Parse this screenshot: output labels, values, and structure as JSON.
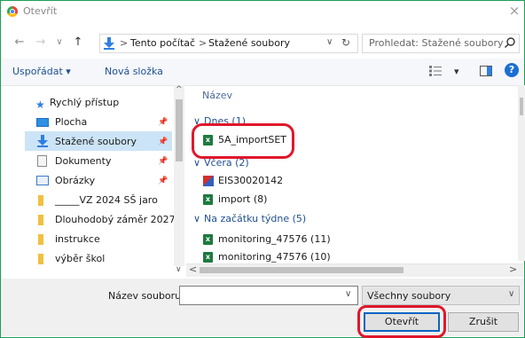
{
  "window": {
    "title": "Otevřít",
    "close": "×"
  },
  "nav": {
    "back": "←",
    "forward": "→",
    "dropdown": "∨",
    "up": "↑",
    "crumbs": [
      "Tento počítač",
      "Stažené soubory"
    ],
    "crumb_sep": ">",
    "addr_dropdown": "∨",
    "refresh": "↻",
    "search_placeholder": "Prohledat: Stažené soubory"
  },
  "toolbar": {
    "organize": "Uspořádat ▾",
    "new_folder": "Nová složka",
    "view_menu": "▾",
    "help": "?"
  },
  "sidebar": {
    "items": [
      {
        "label": "Rychlý přístup",
        "icon": "star-icon"
      },
      {
        "label": "Plocha",
        "icon": "desktop-icon"
      },
      {
        "label": "Stažené soubory",
        "icon": "downloads-icon"
      },
      {
        "label": "Dokumenty",
        "icon": "documents-icon"
      },
      {
        "label": "Obrázky",
        "icon": "pictures-icon"
      },
      {
        "label": "_____VZ 2024 SŠ jaro",
        "icon": "folder-icon"
      },
      {
        "label": "Dlouhodobý záměr 2027",
        "icon": "folder-icon"
      },
      {
        "label": "instrukce",
        "icon": "folder-icon"
      },
      {
        "label": "výběr škol",
        "icon": "folder-icon"
      }
    ]
  },
  "files": {
    "column_header": "Název",
    "groups": [
      {
        "label": "Dnes (1)",
        "items": [
          "5A_importSET"
        ]
      },
      {
        "label": "Včera (2)",
        "items": [
          "EIS30020142",
          "import (8)"
        ]
      },
      {
        "label": "Na začátku týdne (5)",
        "items": [
          "monitoring_47576 (11)",
          "monitoring_47576 (10)"
        ]
      }
    ]
  },
  "footer": {
    "filename_label": "Název souboru:",
    "filename_value": "",
    "filter_value": "Všechny soubory",
    "open_button": "Otevřít",
    "cancel_button": "Zrušit"
  },
  "colors": {
    "accent": "#0a64c2",
    "highlight": "#e0172b",
    "selection": "#cce4f7",
    "frame": "#1f9d55"
  }
}
